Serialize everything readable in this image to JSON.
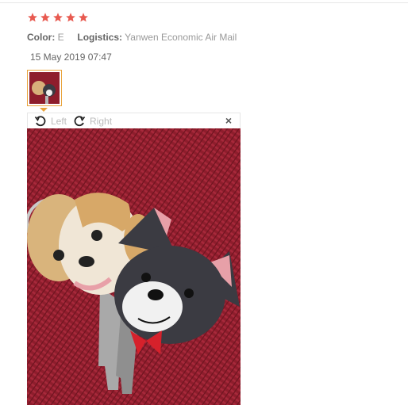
{
  "review": {
    "rating": 5,
    "color_label": "Color:",
    "color_value": "E",
    "logistics_label": "Logistics:",
    "logistics_value": "Yanwen Economic Air Mail",
    "date": "15 May 2019 07:47"
  },
  "viewer": {
    "rotate_left_label": "Left",
    "rotate_right_label": "Right",
    "close_glyph": "×"
  },
  "colors": {
    "star": "#e85a50",
    "thumb_border": "#e9a33b",
    "placemat": "#8e1d2c"
  },
  "icons": [
    "star-icon",
    "rotate-left-icon",
    "rotate-right-icon",
    "close-icon"
  ]
}
